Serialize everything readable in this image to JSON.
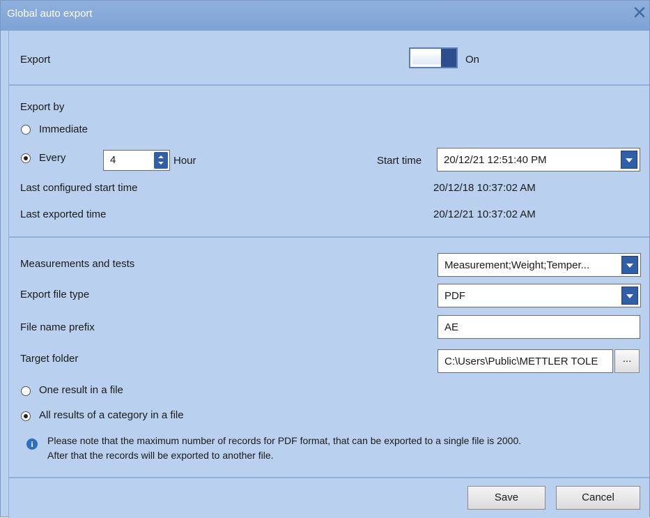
{
  "dialog": {
    "title": "Global auto export"
  },
  "export": {
    "label": "Export",
    "toggle_state": "On"
  },
  "export_by": {
    "heading": "Export by",
    "immediate_label": "Immediate",
    "every_label": "Every",
    "interval_value": "4",
    "interval_unit": "Hour",
    "start_time_label": "Start time",
    "start_time_value": "20/12/21 12:51:40 PM",
    "last_configured_label": "Last configured start time",
    "last_configured_value": "20/12/18 10:37:02 AM",
    "last_exported_label": "Last exported time",
    "last_exported_value": "20/12/21 10:37:02 AM",
    "selected": "Every"
  },
  "settings": {
    "measurements_label": "Measurements and tests",
    "measurements_value": "Measurement;Weight;Temper...",
    "file_type_label": "Export file type",
    "file_type_value": "PDF",
    "prefix_label": "File name prefix",
    "prefix_value": "AE",
    "folder_label": "Target folder",
    "folder_value": "C:\\Users\\Public\\METTLER TOLE",
    "browse_label": "...",
    "one_result_label": "One result in a file",
    "all_results_label": "All results of a category in a file",
    "selected": "All results of a category in a file",
    "info_line1": "Please note that the maximum number of records for PDF format, that can be exported to a single file is 2000.",
    "info_line2": "After that the records will be exported to another file."
  },
  "footer": {
    "save_label": "Save",
    "cancel_label": "Cancel"
  }
}
